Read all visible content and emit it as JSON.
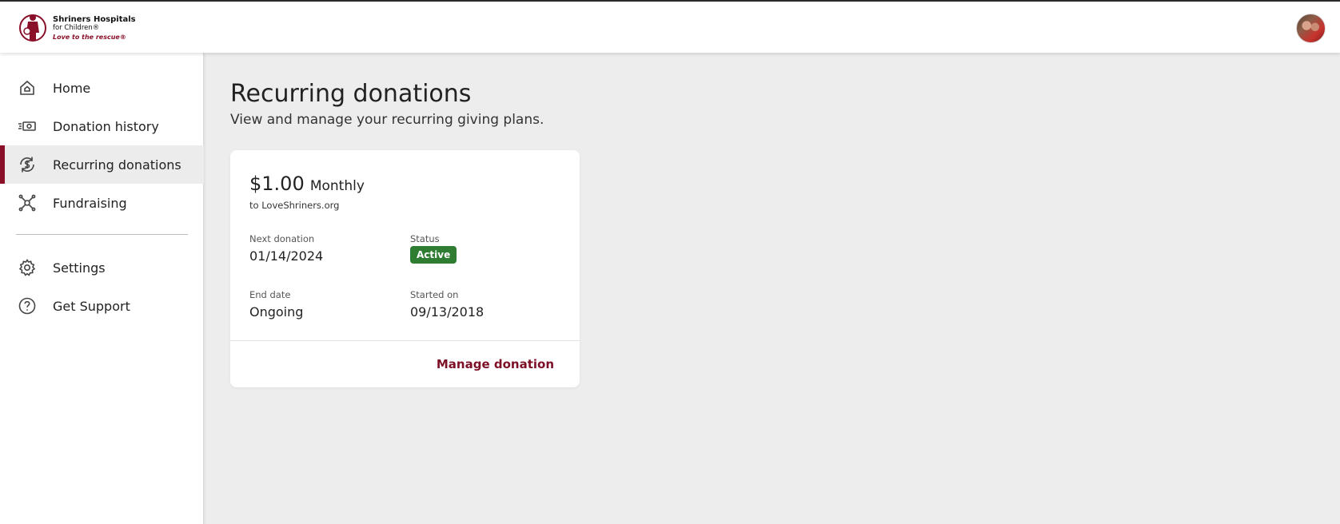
{
  "header": {
    "logo": {
      "line1": "Shriners Hospitals",
      "line2": "for Children®",
      "line3": "Love to the rescue®"
    },
    "avatar_icon": "user-avatar"
  },
  "sidebar": {
    "items": [
      {
        "label": "Home",
        "icon": "home-icon"
      },
      {
        "label": "Donation history",
        "icon": "money-icon"
      },
      {
        "label": "Recurring donations",
        "icon": "recurring-dollar-icon",
        "active": true
      },
      {
        "label": "Fundraising",
        "icon": "fundraising-icon"
      }
    ],
    "secondary_items": [
      {
        "label": "Settings",
        "icon": "gear-icon"
      },
      {
        "label": "Get Support",
        "icon": "help-icon"
      }
    ],
    "accent_color": "#8a1029"
  },
  "main": {
    "title": "Recurring donations",
    "subtitle": "View and manage your recurring giving plans.",
    "card": {
      "amount": "$1.00",
      "frequency": "Monthly",
      "recipient": "to LoveShriners.org",
      "next_donation_label": "Next donation",
      "next_donation_value": "01/14/2024",
      "status_label": "Status",
      "status_value": "Active",
      "status_color": "#2e7d32",
      "end_date_label": "End date",
      "end_date_value": "Ongoing",
      "started_on_label": "Started on",
      "started_on_value": "09/13/2018",
      "manage_label": "Manage donation"
    }
  }
}
